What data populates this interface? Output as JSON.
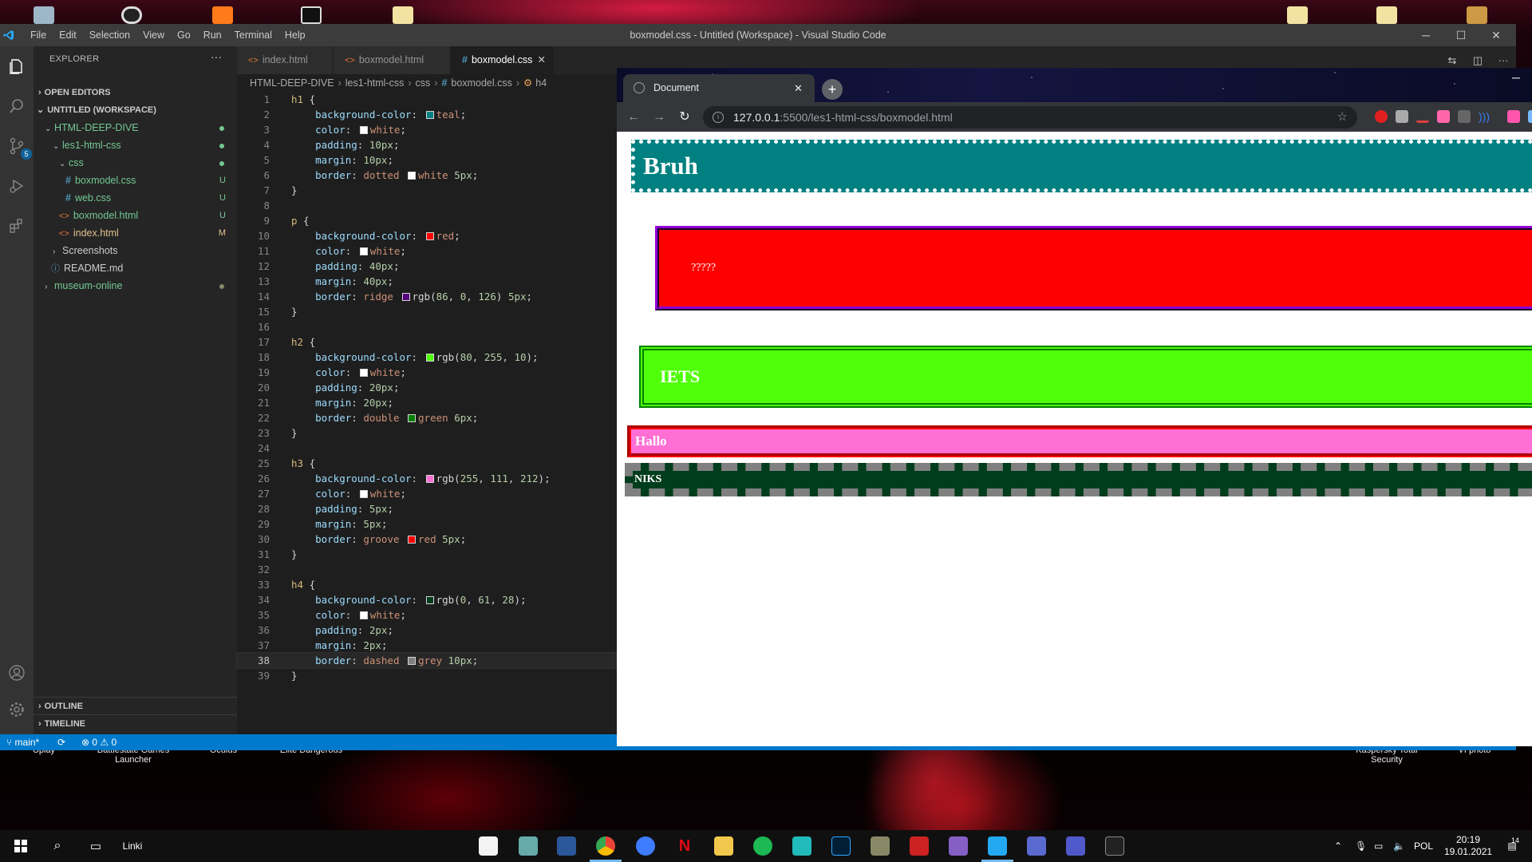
{
  "desktop": {
    "labels": [
      "Uplay",
      "Battlestate Games Launcher",
      "Oculus",
      "Elite Dangerous",
      "Kaspersky Total Security",
      "VI photo"
    ]
  },
  "vscode": {
    "menu": [
      "File",
      "Edit",
      "Selection",
      "View",
      "Go",
      "Run",
      "Terminal",
      "Help"
    ],
    "title": "boxmodel.css - Untitled (Workspace) - Visual Studio Code",
    "window_controls": [
      "─",
      "☐",
      "✕"
    ],
    "activity": {
      "scm_badge": "5"
    },
    "sidebar": {
      "title": "EXPLORER",
      "more": "···",
      "open_editors": "OPEN EDITORS",
      "workspace": "UNTITLED (WORKSPACE)",
      "tree": {
        "root": "HTML-DEEP-DIVE",
        "folder1": "les1-html-css",
        "folder2": "css",
        "file_boxmodel_css": "boxmodel.css",
        "file_web_css": "web.css",
        "file_boxmodel_html": "boxmodel.html",
        "file_index_html": "index.html",
        "folder_screenshots": "Screenshots",
        "file_readme": "README.md",
        "folder_museum": "museum-online",
        "decor_u": "U",
        "decor_m": "M"
      },
      "outline": "OUTLINE",
      "timeline": "TIMELINE"
    },
    "tabs": [
      {
        "label": "index.html"
      },
      {
        "label": "boxmodel.html"
      },
      {
        "label": "boxmodel.css"
      }
    ],
    "tab_close": "✕",
    "breadcrumb": [
      "HTML-DEEP-DIVE",
      "les1-html-css",
      "css",
      "boxmodel.css",
      "h4"
    ],
    "breadcrumb_sep": "›",
    "code_lines": [
      {
        "n": "1",
        "t": "h1 {"
      },
      {
        "n": "2",
        "t": "    background-color: teal;"
      },
      {
        "n": "3",
        "t": "    color: white;"
      },
      {
        "n": "4",
        "t": "    padding: 10px;"
      },
      {
        "n": "5",
        "t": "    margin: 10px;"
      },
      {
        "n": "6",
        "t": "    border: dotted white 5px;"
      },
      {
        "n": "7",
        "t": "}"
      },
      {
        "n": "8",
        "t": ""
      },
      {
        "n": "9",
        "t": "p {"
      },
      {
        "n": "10",
        "t": "    background-color: red;"
      },
      {
        "n": "11",
        "t": "    color: white;"
      },
      {
        "n": "12",
        "t": "    padding: 40px;"
      },
      {
        "n": "13",
        "t": "    margin: 40px;"
      },
      {
        "n": "14",
        "t": "    border: ridge rgb(86, 0, 126) 5px;"
      },
      {
        "n": "15",
        "t": "}"
      },
      {
        "n": "16",
        "t": ""
      },
      {
        "n": "17",
        "t": "h2 {"
      },
      {
        "n": "18",
        "t": "    background-color: rgb(80, 255, 10);"
      },
      {
        "n": "19",
        "t": "    color: white;"
      },
      {
        "n": "20",
        "t": "    padding: 20px;"
      },
      {
        "n": "21",
        "t": "    margin: 20px;"
      },
      {
        "n": "22",
        "t": "    border: double green 6px;"
      },
      {
        "n": "23",
        "t": "}"
      },
      {
        "n": "24",
        "t": ""
      },
      {
        "n": "25",
        "t": "h3 {"
      },
      {
        "n": "26",
        "t": "    background-color: rgb(255, 111, 212);"
      },
      {
        "n": "27",
        "t": "    color: white;"
      },
      {
        "n": "28",
        "t": "    padding: 5px;"
      },
      {
        "n": "29",
        "t": "    margin: 5px;"
      },
      {
        "n": "30",
        "t": "    border: groove red 5px;"
      },
      {
        "n": "31",
        "t": "}"
      },
      {
        "n": "32",
        "t": ""
      },
      {
        "n": "33",
        "t": "h4 {"
      },
      {
        "n": "34",
        "t": "    background-color: rgb(0, 61, 28);"
      },
      {
        "n": "35",
        "t": "    color: white;"
      },
      {
        "n": "36",
        "t": "    padding: 2px;"
      },
      {
        "n": "37",
        "t": "    margin: 2px;"
      },
      {
        "n": "38",
        "t": "    border: dashed grey 10px;"
      },
      {
        "n": "39",
        "t": "}"
      }
    ],
    "current_line": "38",
    "status": {
      "branch": "main*",
      "sync": "⟳",
      "problems": "⊗ 0 ⚠ 0"
    }
  },
  "chrome": {
    "tab_title": "Document",
    "tab_close": "✕",
    "new_tab": "+",
    "minimize": "─",
    "back": "←",
    "forward": "→",
    "reload": "↻",
    "url_host": "127.0.0.1",
    "url_rest": ":5500/les1-html-css/boxmodel.html",
    "star": "☆",
    "page": {
      "h1": "Bruh",
      "p": "?????",
      "h2": "IETS",
      "h3": "Hallo",
      "h4": "NIKS"
    }
  },
  "taskbar": {
    "search_label": "Linki",
    "tray_lang": "POL",
    "time": "20:19",
    "date": "19.01.2021",
    "notif_count": "14"
  },
  "colors": {
    "accent": "#007acc",
    "h1_bg": "teal",
    "p_bg": "red",
    "h2_bg": "rgb(80,255,10)",
    "h3_bg": "rgb(255,111,212)",
    "h4_bg": "rgb(0,61,28)"
  }
}
